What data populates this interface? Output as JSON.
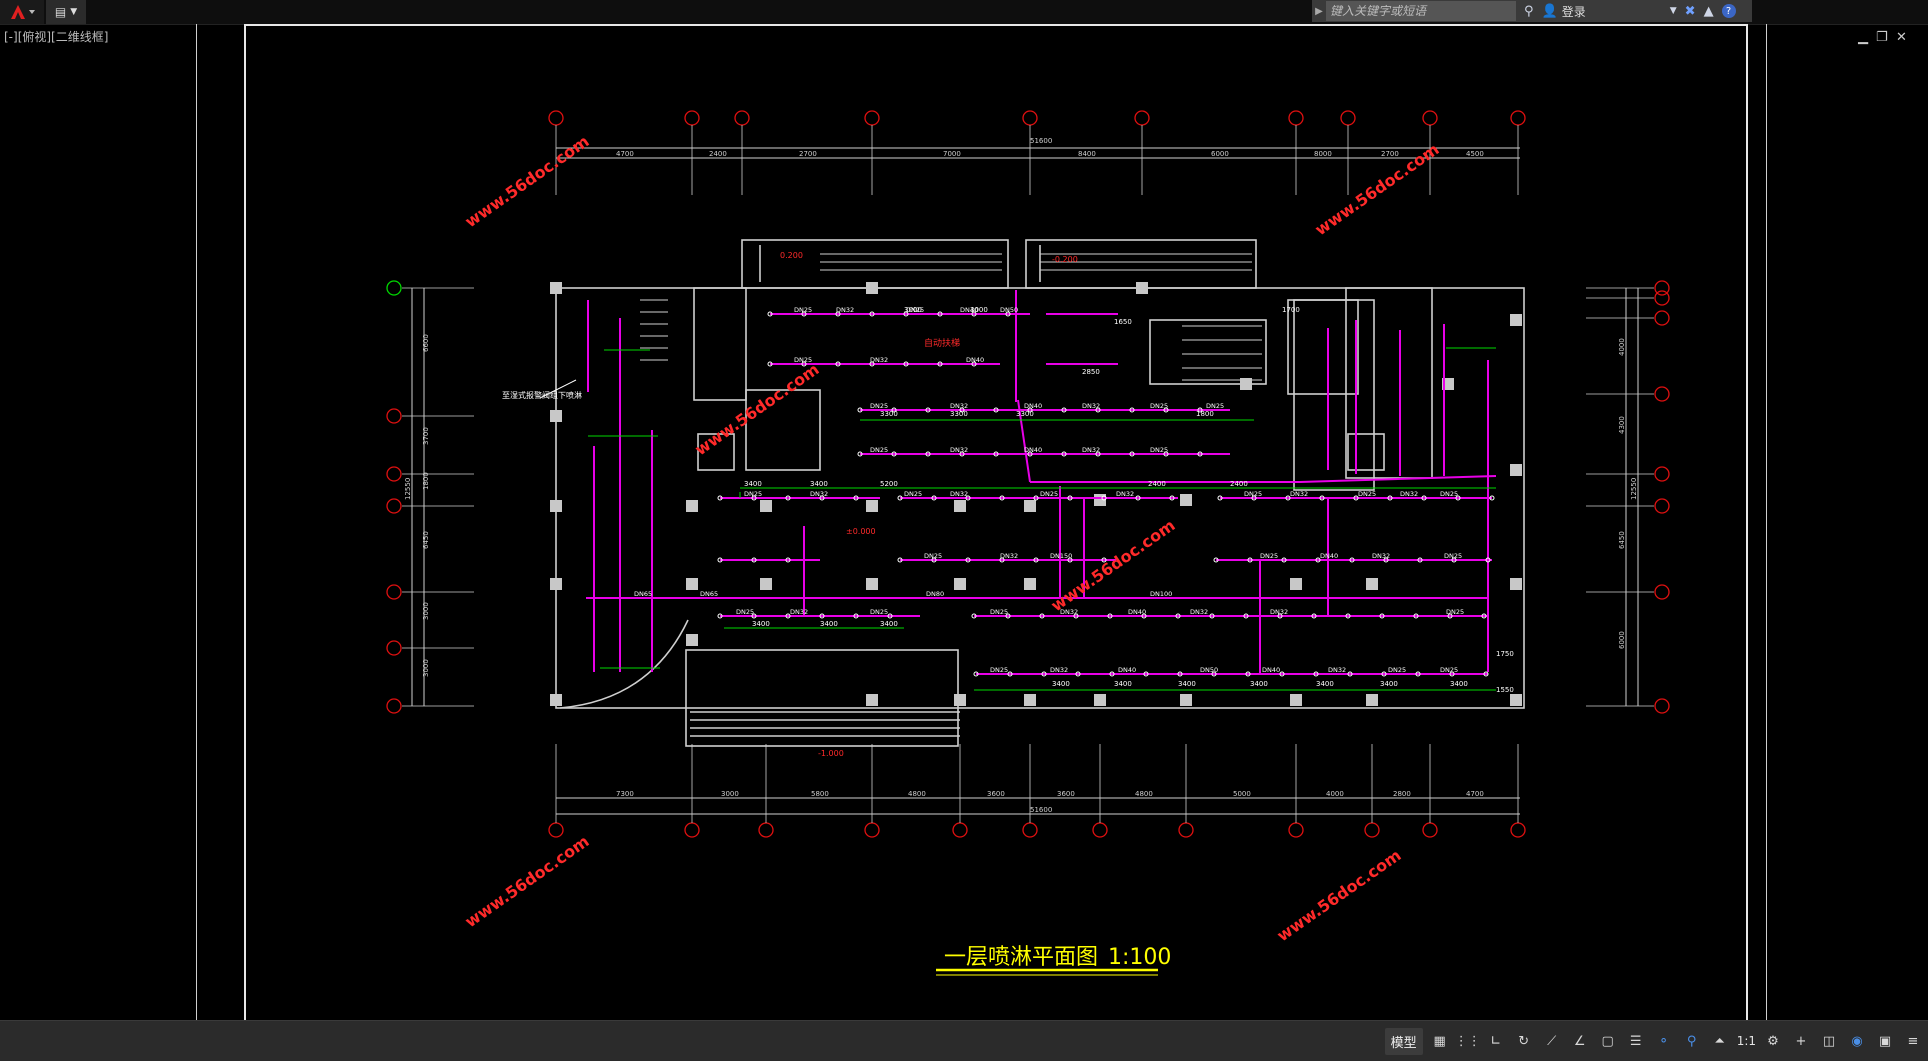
{
  "toolbar": {
    "search_placeholder": "键入关键字或短语",
    "login_label": "登录",
    "view_label": "[-][俯视][二维线框]"
  },
  "drawing": {
    "title": "一层喷淋平面图",
    "scale": "1:100",
    "watermark": "www.56doc.com",
    "top_dims": [
      "4700",
      "2400",
      "2700",
      "7000",
      "8400",
      "6000",
      "8000",
      "2700",
      "4500",
      "4700"
    ],
    "top_total": "51600",
    "bottom_dims": [
      "7300",
      "3000",
      "5800",
      "4800",
      "3600",
      "3600",
      "4800",
      "5000",
      "4000",
      "2800",
      "4700"
    ],
    "bottom_total": "51600",
    "left_dims": [
      "6600",
      "3700",
      "1800",
      "6450",
      "3000",
      "3000"
    ],
    "left_total": "12550",
    "right_dims": [
      "4000",
      "4300",
      "6450",
      "6000"
    ],
    "right_total": "12550",
    "pipe_labels": [
      "DN25",
      "DN32",
      "DN40",
      "DN50",
      "DN65",
      "DN80",
      "DN100",
      "DN150"
    ],
    "spacing_labels": [
      "3400",
      "3300",
      "3000",
      "2400",
      "1700",
      "1650",
      "2850",
      "1750",
      "1550",
      "1800",
      "5200"
    ],
    "level_labels": [
      "-0.200",
      "±0.000",
      "-1.000",
      "0.200"
    ],
    "note_text": "至湿式报警阀组下喷淋",
    "room_label": "自动扶梯"
  },
  "statusbar": {
    "model_label": "模型",
    "scale_label": "1:1"
  },
  "colors": {
    "pipe": "#e800e8",
    "dim": "#00e000",
    "wall": "#d0d0d0",
    "axis": "#e01010",
    "watermark": "#ff2a2a",
    "title": "#ffff00"
  }
}
